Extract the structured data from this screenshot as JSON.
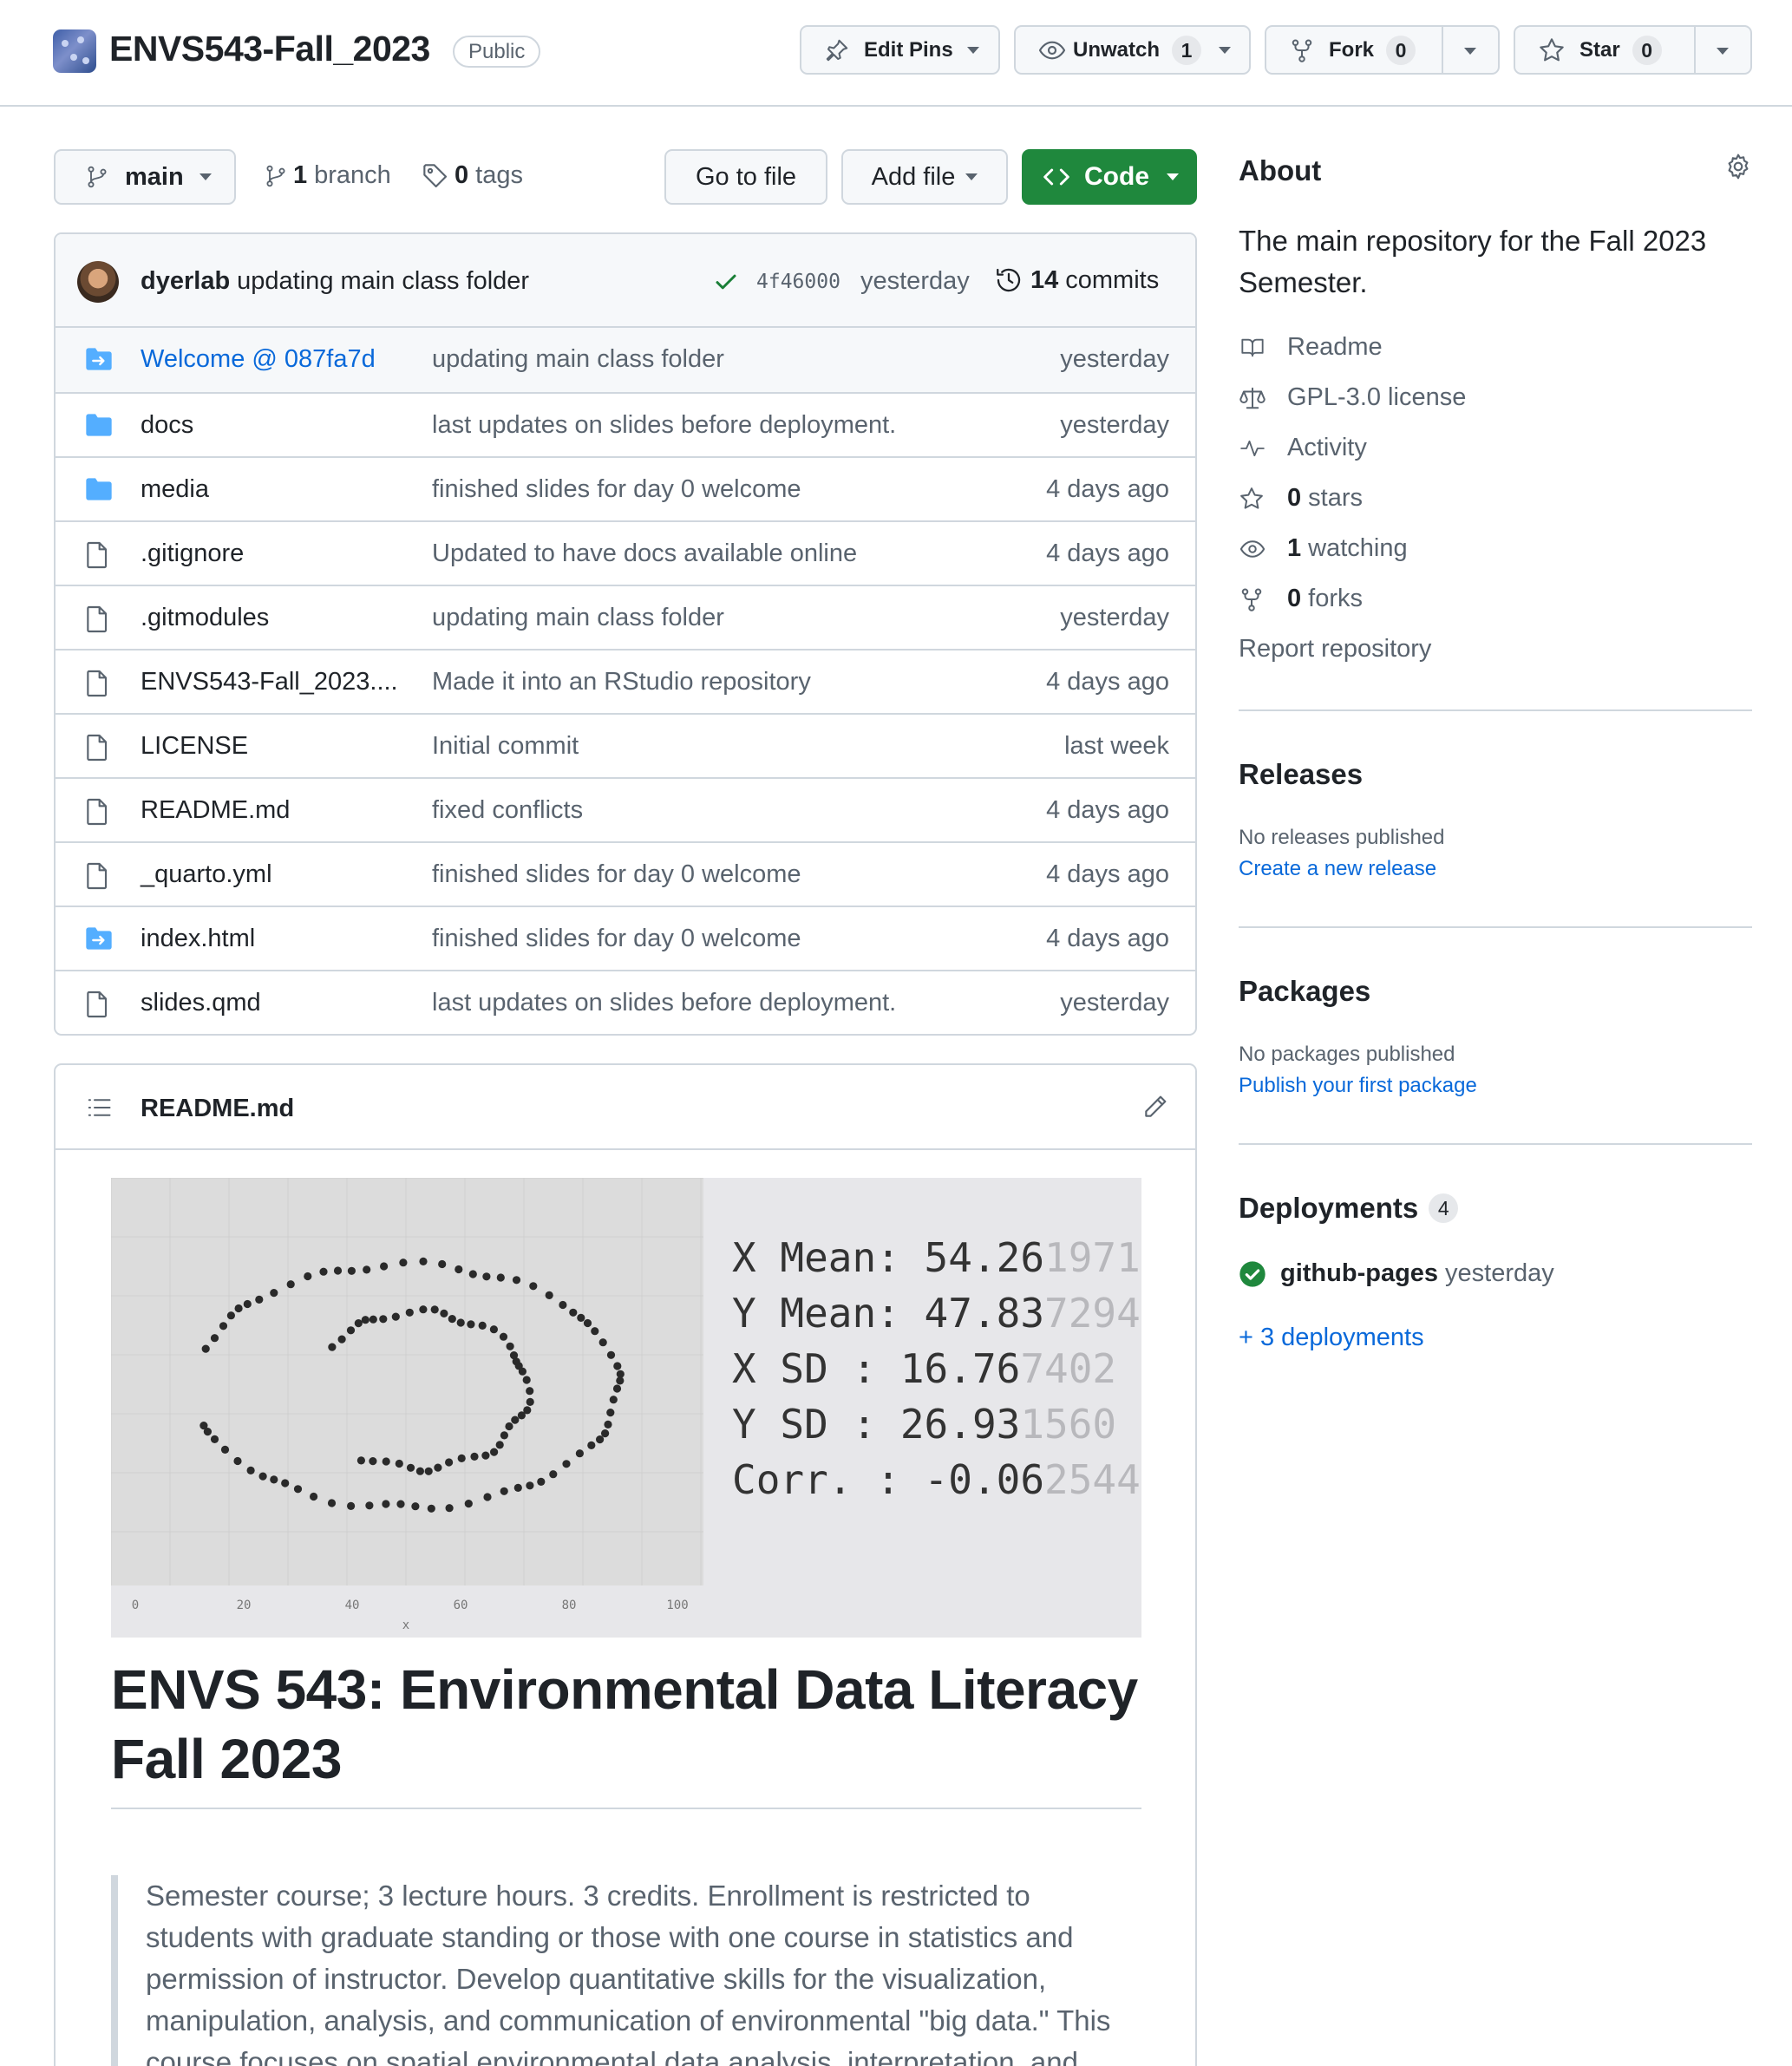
{
  "repo": {
    "name": "ENVS543-Fall_2023",
    "visibility": "Public",
    "edit_pins": "Edit Pins",
    "unwatch": "Unwatch",
    "watch_count": "1",
    "fork": "Fork",
    "fork_count": "0",
    "star": "Star",
    "star_count": "0"
  },
  "toolbar": {
    "branch": "main",
    "branch_count": "1",
    "branch_label": "branch",
    "tag_count": "0",
    "tag_label": "tags",
    "go_to_file": "Go to file",
    "add_file": "Add file",
    "code": "Code"
  },
  "latest_commit": {
    "author": "dyerlab",
    "message": "updating main class folder",
    "sha": "4f46000",
    "date": "yesterday",
    "commits_count": "14",
    "commits_label": "commits"
  },
  "files": [
    {
      "name": "Welcome @ 087fa7d",
      "message": "updating main class folder",
      "date": "yesterday",
      "icon": "submodule-icon"
    },
    {
      "name": "docs",
      "message": "last updates on slides before deployment.",
      "date": "yesterday",
      "icon": "folder-icon"
    },
    {
      "name": "media",
      "message": "finished slides for day 0 welcome",
      "date": "4 days ago",
      "icon": "folder-icon"
    },
    {
      "name": ".gitignore",
      "message": "Updated to have docs available online",
      "date": "4 days ago",
      "icon": "file-icon"
    },
    {
      "name": ".gitmodules",
      "message": "updating main class folder",
      "date": "yesterday",
      "icon": "file-icon"
    },
    {
      "name": "ENVS543-Fall_2023....",
      "message": "Made it into an RStudio repository",
      "date": "4 days ago",
      "icon": "file-icon"
    },
    {
      "name": "LICENSE",
      "message": "Initial commit",
      "date": "last week",
      "icon": "file-icon"
    },
    {
      "name": "README.md",
      "message": "fixed conflicts",
      "date": "4 days ago",
      "icon": "file-icon"
    },
    {
      "name": "_quarto.yml",
      "message": "finished slides for day 0 welcome",
      "date": "4 days ago",
      "icon": "file-icon"
    },
    {
      "name": "index.html",
      "message": "finished slides for day 0 welcome",
      "date": "4 days ago",
      "icon": "submodule-icon"
    },
    {
      "name": "slides.qmd",
      "message": "last updates on slides before deployment.",
      "date": "yesterday",
      "icon": "file-icon"
    }
  ],
  "readme": {
    "filename": "README.md",
    "heading": "ENVS 543: Environmental Data Literacy Fall 2023",
    "quote": "Semester course; 3 lecture hours. 3 credits. Enrollment is restricted to students with graduate standing or those with one course in statistics and permission of instructor. Develop quantitative skills for the visualization, manipulation, analysis, and communication of environmental \"big data.\" This course focuses on spatial environmental data analysis, interpretation, and"
  },
  "banner": {
    "stats": [
      {
        "label": "X Mean:",
        "value_dark": "54.26",
        "value_light": "1971"
      },
      {
        "label": "Y Mean:",
        "value_dark": "47.83",
        "value_light": "7294"
      },
      {
        "label": "X SD  :",
        "value_dark": "16.76",
        "value_light": "7402"
      },
      {
        "label": "Y SD  :",
        "value_dark": "26.93",
        "value_light": "1560"
      },
      {
        "label": "Corr. :",
        "value_dark": "-0.06",
        "value_light": "2544"
      }
    ],
    "xticks": [
      "0",
      "20",
      "40",
      "60",
      "80",
      "100"
    ],
    "xlabel": "x"
  },
  "about": {
    "title": "About",
    "description": "The main repository for the Fall 2023 Semester.",
    "readme": "Readme",
    "license": "GPL-3.0 license",
    "activity": "Activity",
    "stars_count": "0",
    "stars_label": "stars",
    "watching_count": "1",
    "watching_label": "watching",
    "forks_count": "0",
    "forks_label": "forks",
    "report": "Report repository"
  },
  "releases": {
    "title": "Releases",
    "empty": "No releases published",
    "link": "Create a new release"
  },
  "packages": {
    "title": "Packages",
    "empty": "No packages published",
    "link": "Publish your first package"
  },
  "deployments": {
    "title": "Deployments",
    "count": "4",
    "env": "github-pages",
    "date": "yesterday",
    "more": "+ 3 deployments"
  },
  "colors": {
    "accent": "#0969da",
    "success": "#1f883d",
    "border": "#d0d7de",
    "muted": "#59636e"
  }
}
